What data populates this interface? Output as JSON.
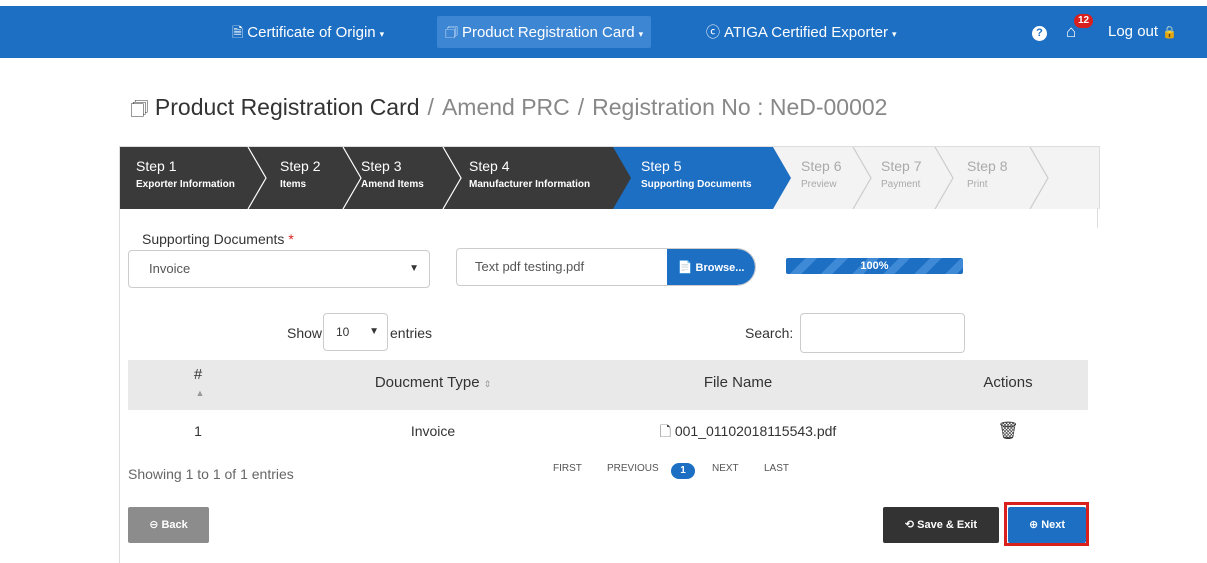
{
  "nav": {
    "coo_label": "Certificate of Origin",
    "prc_label": "Product Registration Card",
    "atiga_label": "ATIGA Certified Exporter",
    "notification_count": "12",
    "logout_label": "Log out"
  },
  "title": {
    "main": "Product Registration Card",
    "crumb1": "Amend PRC",
    "crumb2": "Registration No : NeD-00002",
    "sep": "/"
  },
  "steps": [
    {
      "num": "Step 1",
      "label": "Exporter Information",
      "state": "done"
    },
    {
      "num": "Step 2",
      "label": "Items",
      "state": "done"
    },
    {
      "num": "Step 3",
      "label": "Amend Items",
      "state": "done"
    },
    {
      "num": "Step 4",
      "label": "Manufacturer Information",
      "state": "done"
    },
    {
      "num": "Step 5",
      "label": "Supporting Documents",
      "state": "current"
    },
    {
      "num": "Step 6",
      "label": "Preview",
      "state": "todo"
    },
    {
      "num": "Step 7",
      "label": "Payment",
      "state": "todo"
    },
    {
      "num": "Step 8",
      "label": "Print",
      "state": "todo"
    }
  ],
  "form": {
    "doc_label": "Supporting Documents",
    "required_mark": "*",
    "doc_selected": "Invoice",
    "file_name": "Text pdf testing.pdf",
    "browse_label": "Browse...",
    "progress_text": "100%",
    "progress_value": 100
  },
  "table_controls": {
    "show_label": "Show",
    "entries_value": "10",
    "entries_label": "entries",
    "search_label": "Search:"
  },
  "table": {
    "headers": [
      "#",
      "Doucment Type",
      "File Name",
      "Actions"
    ],
    "rows": [
      {
        "no": "1",
        "type": "Invoice",
        "file": "001_01102018115543.pdf"
      }
    ],
    "showing": "Showing 1 to 1 of 1 entries"
  },
  "pager": {
    "first": "FIRST",
    "previous": "PREVIOUS",
    "current": "1",
    "next": "NEXT",
    "last": "LAST"
  },
  "buttons": {
    "back": "Back",
    "save_exit": "Save & Exit",
    "next": "Next"
  },
  "colors": {
    "primary": "#1d6fc4",
    "dark_step": "#3a3a3a",
    "highlight": "#d9201c"
  }
}
